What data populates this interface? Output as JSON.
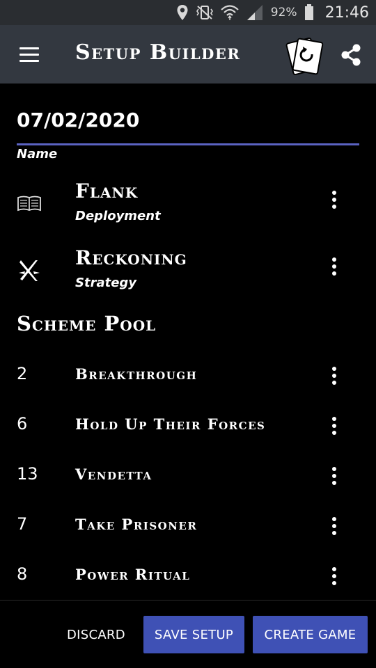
{
  "status_bar": {
    "battery_percent": "92%",
    "time": "21:46",
    "icons": [
      "location-icon",
      "vibrate-icon",
      "wifi-icon",
      "signal-icon",
      "battery-icon"
    ]
  },
  "app_bar": {
    "title": "Setup Builder",
    "icons": [
      "menu-icon",
      "cards-reset-icon",
      "share-icon"
    ]
  },
  "form": {
    "name_value": "07/02/2020",
    "name_label": "Name",
    "accent_color": "#5b63c2"
  },
  "setup": [
    {
      "title": "Flank",
      "subtitle": "Deployment",
      "icon": "book-icon"
    },
    {
      "title": "Reckoning",
      "subtitle": "Strategy",
      "icon": "crossed-swords-icon"
    }
  ],
  "scheme_pool": {
    "heading": "Scheme Pool",
    "items": [
      {
        "number": "2",
        "name": "Breakthrough"
      },
      {
        "number": "6",
        "name": "Hold Up Their Forces"
      },
      {
        "number": "13",
        "name": "Vendetta"
      },
      {
        "number": "7",
        "name": "Take Prisoner"
      },
      {
        "number": "8",
        "name": "Power Ritual"
      }
    ]
  },
  "actions": {
    "discard": "DISCARD",
    "save": "SAVE SETUP",
    "create": "CREATE GAME",
    "button_color": "#3f51b5"
  }
}
